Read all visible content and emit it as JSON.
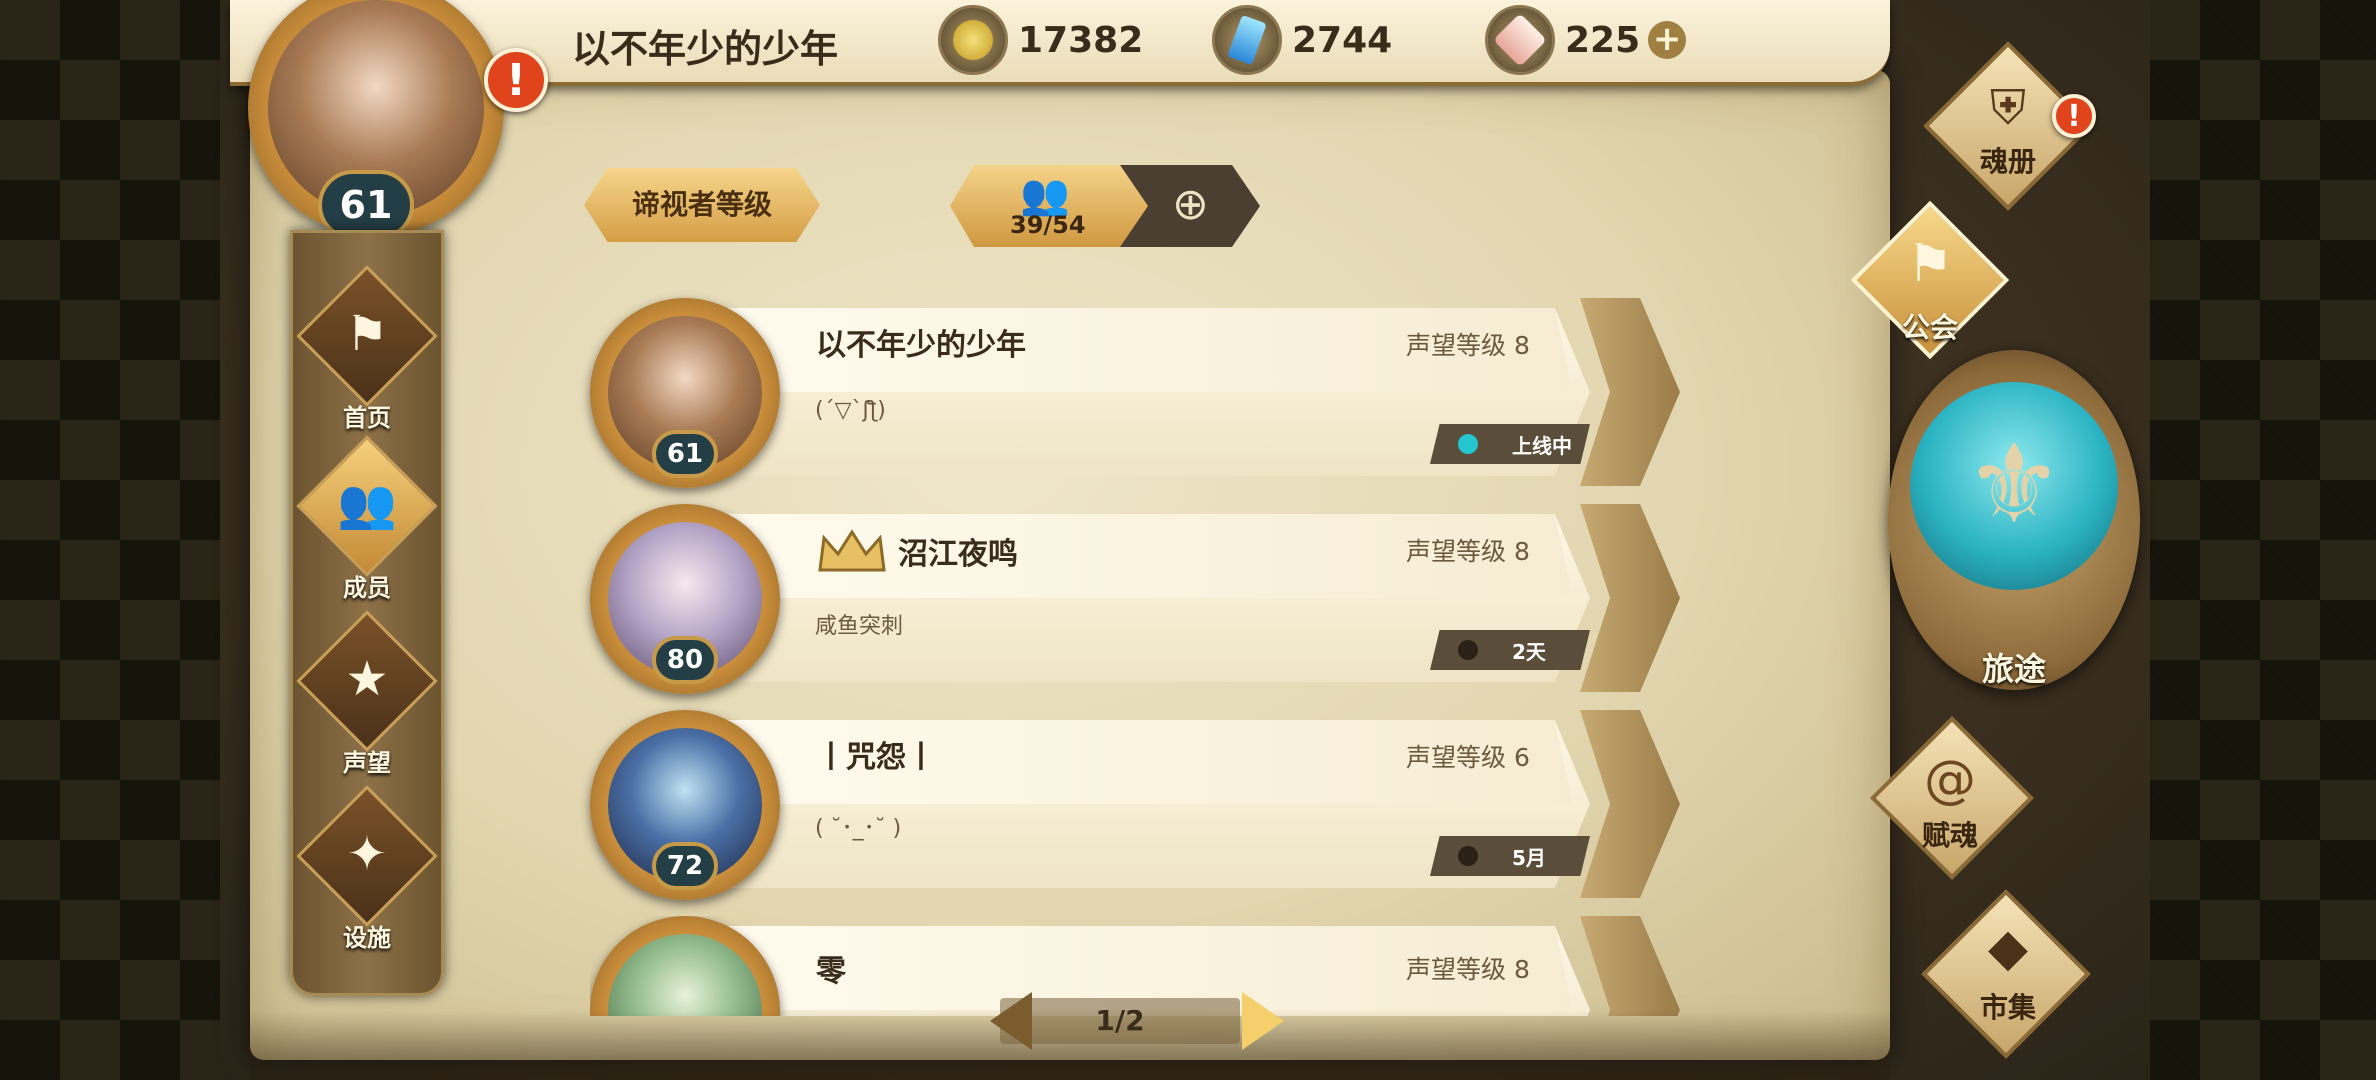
{
  "header": {
    "player_name": "以不年少的少年",
    "player_level": "61",
    "currencies": [
      {
        "icon": "gold-coin-icon",
        "value": "17382"
      },
      {
        "icon": "blue-crystal-icon",
        "value": "2744"
      },
      {
        "icon": "soul-gem-icon",
        "value": "225"
      }
    ],
    "add_label": "+"
  },
  "left_nav": {
    "items": [
      {
        "label": "首页",
        "icon": "guild-flag-icon"
      },
      {
        "label": "成员",
        "icon": "members-icon",
        "active": true
      },
      {
        "label": "声望",
        "icon": "laurel-star-icon"
      },
      {
        "label": "设施",
        "icon": "facility-emblem-icon"
      }
    ]
  },
  "toolbar": {
    "rank_button": "谛视者等级",
    "member_count": "39/54"
  },
  "members": [
    {
      "name": "以不年少的少年",
      "level": "61",
      "prestige": "声望等级 8",
      "motto": "(´▽`ʃƪ)",
      "status": "上线中",
      "online": true,
      "leader": false
    },
    {
      "name": "沼江夜鸣",
      "level": "80",
      "prestige": "声望等级 8",
      "motto": "咸鱼突刺",
      "status": "2天",
      "online": false,
      "leader": true
    },
    {
      "name": "丨咒怨丨",
      "level": "72",
      "prestige": "声望等级 6",
      "motto": "( ˘･_･˘ )",
      "status": "5月",
      "online": false,
      "leader": false
    },
    {
      "name": "零",
      "level": "",
      "prestige": "声望等级 8",
      "motto": "",
      "status": "",
      "online": false,
      "leader": false
    }
  ],
  "pager": {
    "text": "1/2"
  },
  "right_nav": {
    "soul_book": "魂册",
    "guild": "公会",
    "journey": "旅途",
    "soul_grant": "赋魂",
    "market": "市集"
  },
  "colors": {
    "online": "#26c6d0",
    "offline": "#2a2216",
    "accent": "#e0441c",
    "journey": "#2ab3c2"
  }
}
